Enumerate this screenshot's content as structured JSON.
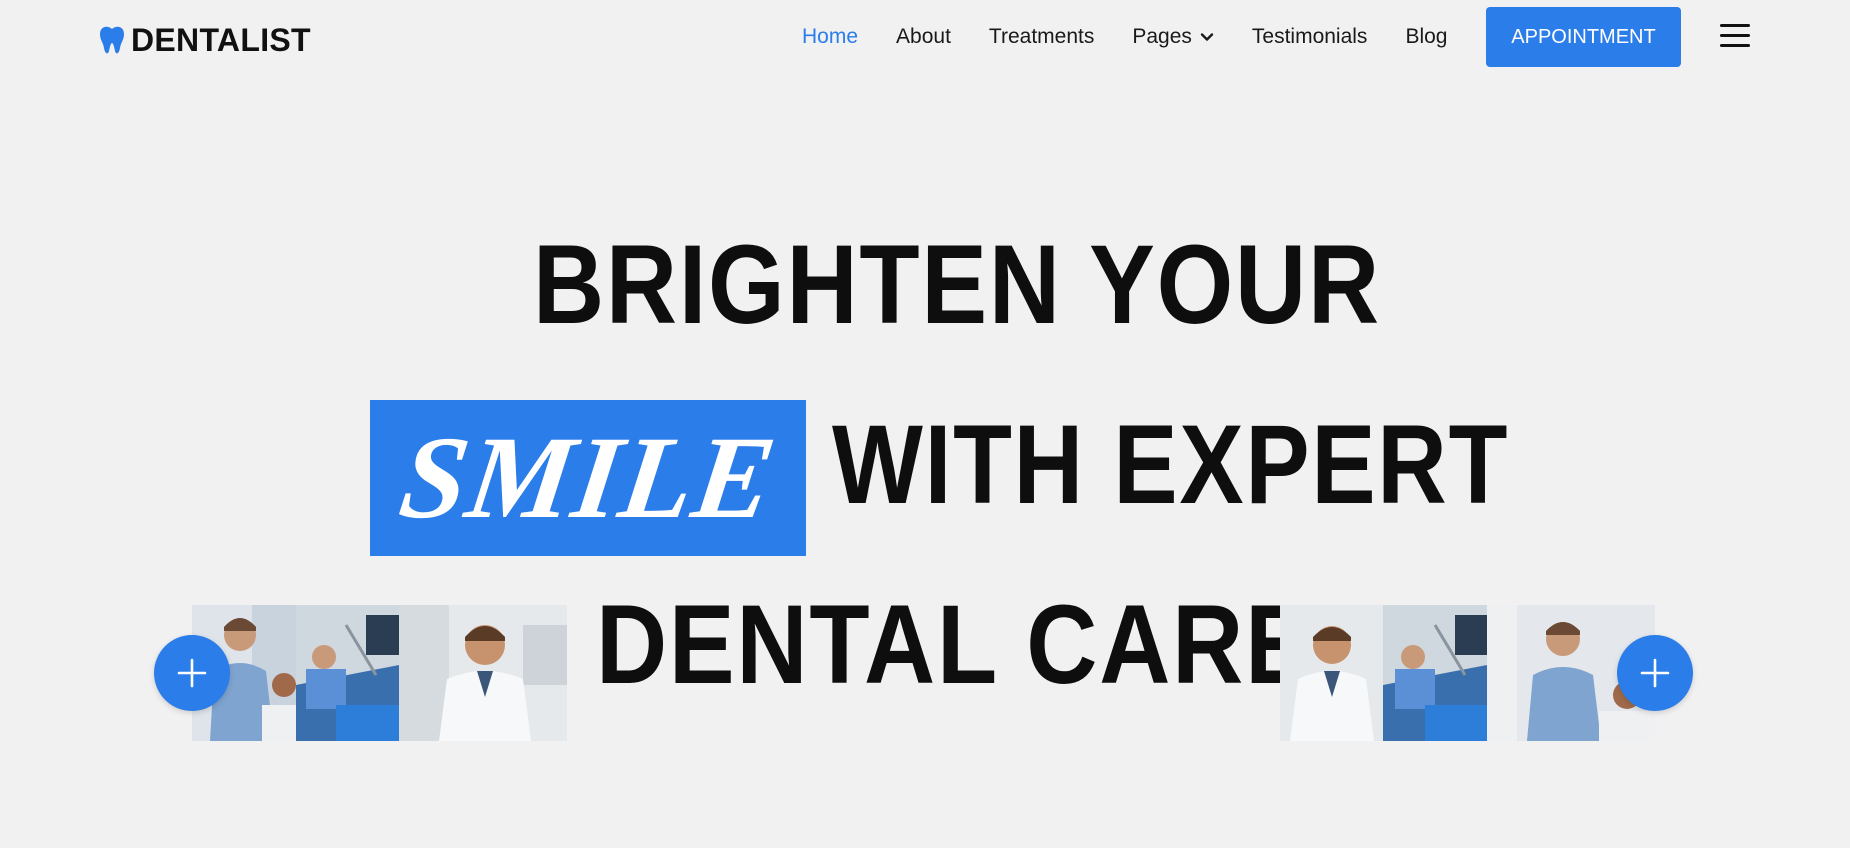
{
  "brand": {
    "name": "DENTALIST",
    "color": "#2b7de9"
  },
  "nav": {
    "items": [
      {
        "label": "Home",
        "active": true
      },
      {
        "label": "About",
        "active": false
      },
      {
        "label": "Treatments",
        "active": false
      },
      {
        "label": "Pages",
        "active": false,
        "has_dropdown": true
      },
      {
        "label": "Testimonials",
        "active": false
      },
      {
        "label": "Blog",
        "active": false
      }
    ],
    "cta_label": "APPOINTMENT",
    "menu_icon": "hamburger-menu-icon"
  },
  "hero": {
    "line1": "BRIGHTEN YOUR",
    "highlight": "SMILE",
    "line2": "WITH EXPERT",
    "line3": "DENTAL CARE"
  },
  "photos": {
    "left": [
      "dentist-treating-patient",
      "dental-chair-procedure",
      "smiling-dentist-portrait"
    ],
    "right": [
      "smiling-dentist-portrait",
      "dental-chair-procedure",
      "dentist-treating-patient"
    ]
  },
  "icons": {
    "plus": "plus-icon",
    "tooth": "tooth-logo-icon",
    "chevron": "chevron-down-icon"
  }
}
